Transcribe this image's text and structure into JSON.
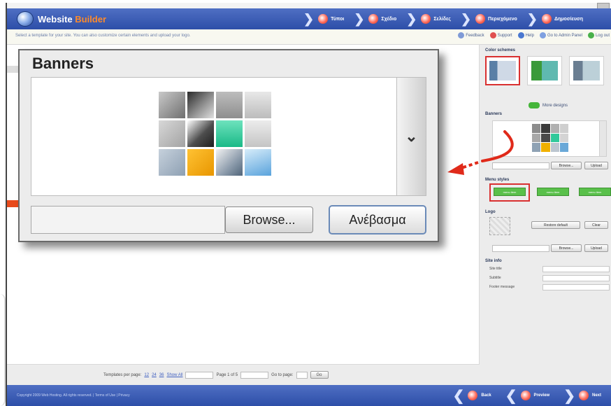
{
  "app": {
    "title_part1": "Website",
    "title_part2": "Builder"
  },
  "steps": [
    {
      "label": "Τύποι",
      "icon": "step-icon"
    },
    {
      "label": "Σχέδιο",
      "icon": "step-icon"
    },
    {
      "label": "Σελίδες",
      "icon": "step-icon"
    },
    {
      "label": "Περιεχόμενο",
      "icon": "step-icon"
    },
    {
      "label": "Δημοσίευση",
      "icon": "step-icon"
    }
  ],
  "infobar": {
    "message": "Select a template for your site. You can also customize certain elements and upload your logo.",
    "links": [
      "Feedback",
      "Support",
      "Help",
      "Go to Admin Panel",
      "Log out"
    ]
  },
  "panel": {
    "color_schemes_title": "Color schemes",
    "more_label": "More designs",
    "banners_title": "Banners",
    "browse_small": "Browse...",
    "upload_small": "Upload",
    "menu_styles_title": "Menu styles",
    "menu_style_label": "menu item",
    "logo_title": "Logo",
    "restore_default": "Restore default",
    "clear": "Clear",
    "browse_small_2": "Browse...",
    "upload_small_2": "Upload",
    "site_info_title": "Site info",
    "site_title_label": "Site title",
    "subtitle_label": "Subtitle",
    "footer_message_label": "Footer message"
  },
  "pager": {
    "templates_per_page": "Templates per page:",
    "opt1": "12",
    "opt2": "24",
    "opt3": "36",
    "show_all": "Show All",
    "page_of": "Page 1 of 5",
    "go_to_page": "Go to page:",
    "go_button": "Go"
  },
  "footer": {
    "copyright": "Copyright 2009 Web Hosting. All rights reserved. | Terms of Use | Privacy",
    "back": "Back",
    "preview": "Preview",
    "next": "Next"
  },
  "dialog": {
    "title": "Banners",
    "browse_label": "Browse...",
    "upload_label": "Ανέβασμα",
    "scroll_icon": "chevron-down-icon"
  },
  "colors": {
    "header_blue": "#2d4ea8",
    "highlight_red": "#d93030",
    "menu_green": "#59c04a",
    "accent_orange": "#ff8a2a"
  }
}
